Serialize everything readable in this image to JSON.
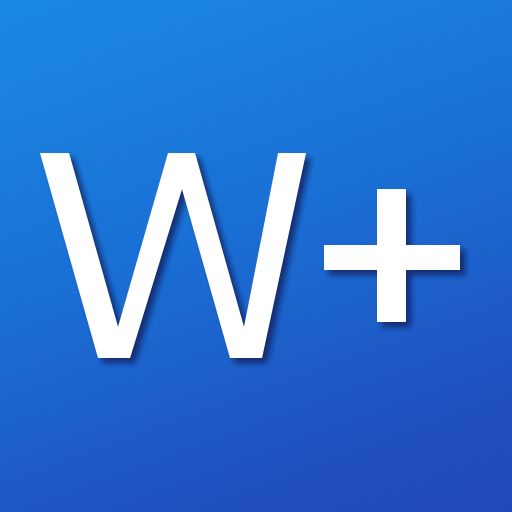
{
  "icon": {
    "name": "W+ app icon",
    "logo_text": "W+",
    "background_top": "#1a89e3",
    "background_bottom": "#2148b6",
    "glyph_color": "#ffffff",
    "shadow_color": "#0b1f55"
  }
}
